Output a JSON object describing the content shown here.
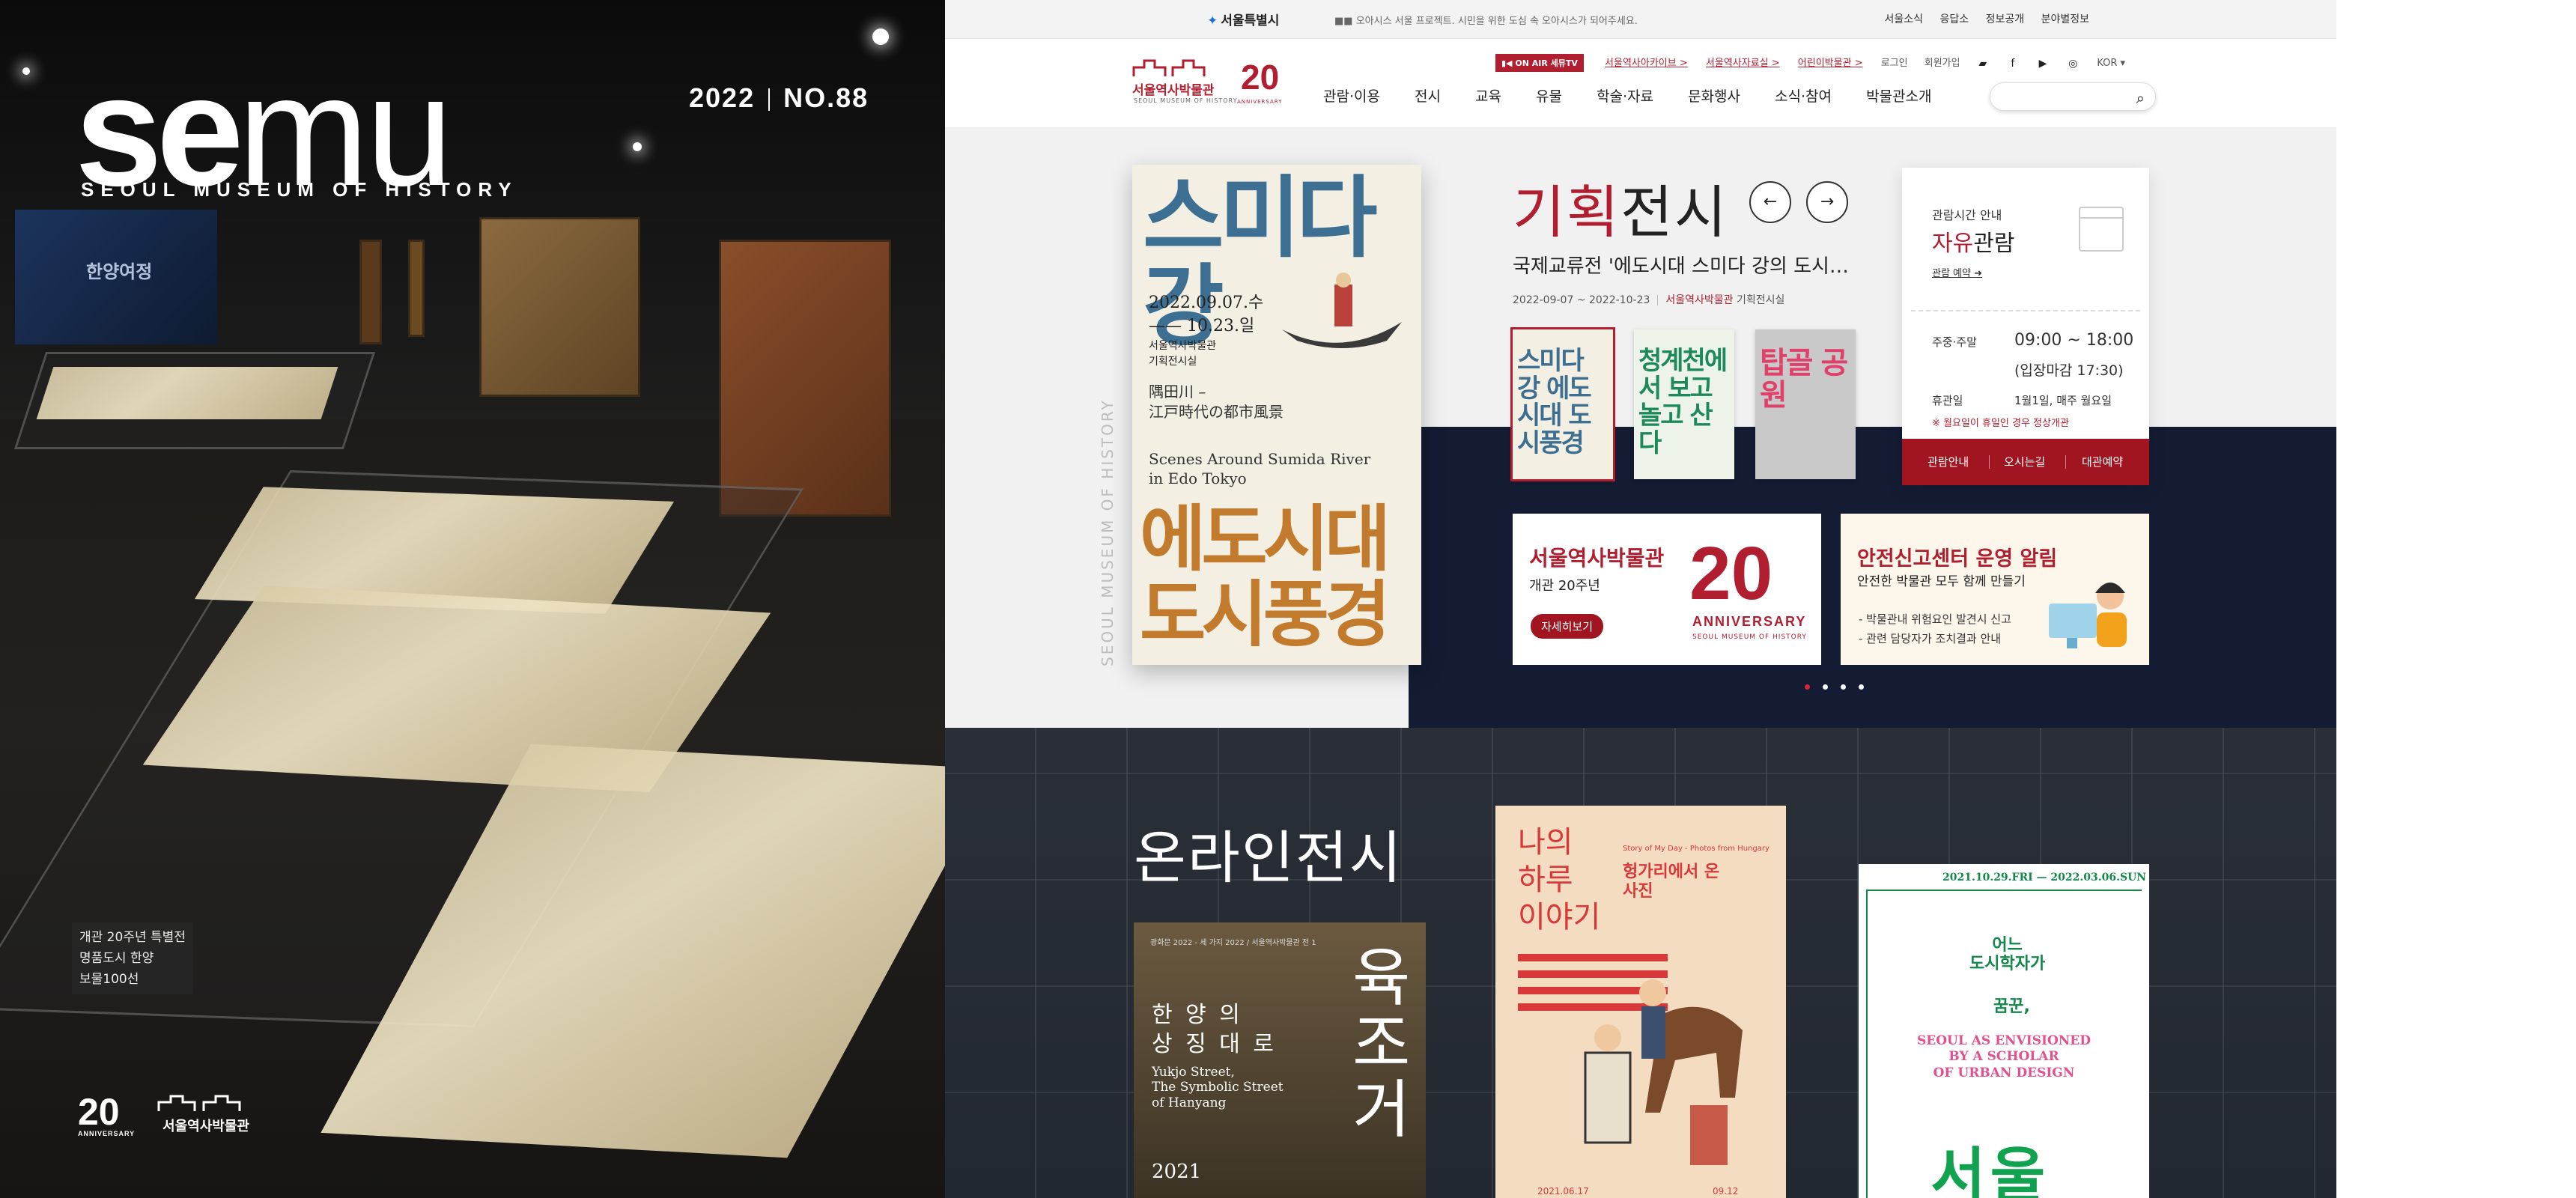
{
  "cover": {
    "logo_bold": "se",
    "logo_thin": "mu",
    "subtitle": "SEOUL MUSEUM OF HISTORY",
    "year": "2022",
    "issue": "NO.88",
    "screen_label": "한양여정",
    "caption_lines": [
      "개관 20주년 특별전",
      "명품도시 한양",
      "보물100선"
    ],
    "anniv_number": "20",
    "anniv_label": "ANNIVERSARY",
    "museum_name": "서울역사박물관"
  },
  "gov_bar": {
    "logo": "서울특별시",
    "message": "■■ 오아시스 서울 프로젝트. 시민을 위한 도심 속 오아시스가 되어주세요.",
    "links": [
      "서울소식",
      "응답소",
      "정보공개",
      "분야별정보"
    ]
  },
  "header": {
    "brand_name": "서울역사박물관",
    "brand_eng": "SEOUL MUSEUM OF HISTORY",
    "anniv_20": "20",
    "anniv_label": "ANNIVERSARY",
    "onair": "▮◀ ON AIR 세뮤TV",
    "util_links": [
      "서울역사아카이브 >",
      "서울역사자료실 >",
      "어린이박물관 >"
    ],
    "login": "로그인",
    "join": "회원가입",
    "lang": "KOR ▾",
    "gnb": [
      "관람·이용",
      "전시",
      "교육",
      "유물",
      "학술·자료",
      "문화행사",
      "소식·참여",
      "박물관소개"
    ],
    "search_placeholder": ""
  },
  "hero": {
    "vertical_text": "SEOUL MUSEUM OF HISTORY",
    "poster": {
      "title_block": "스미다 강",
      "date_lines": [
        "2022.09.07.수",
        "—— 10.23.일"
      ],
      "place_lines": [
        "서울역사박물관",
        "기획전시실"
      ],
      "jp_lines": [
        "隅田川 –",
        "江戸時代の都市風景"
      ],
      "en_lines": [
        "Scenes Around Sumida River",
        "in Edo Tokyo"
      ],
      "big_text": "에도시대 도시풍경"
    },
    "title_accent": "기획",
    "title_rest": "전시",
    "exhibit_title": "국제교류전 '에도시대 스미다 강의 도시…",
    "period": "2022-09-07 ~ 2022-10-23",
    "venue": "서울역사박물관",
    "room": "기획전시실",
    "thumbs": [
      {
        "text": "스미다 강 에도시대 도시풍경",
        "bg": "#f4efe3",
        "color": "#3d6f92"
      },
      {
        "text": "청계천에서 보고 놀고 산다",
        "bg": "#eef3ea",
        "color": "#1c8a58"
      },
      {
        "text": "탑골 공원",
        "bg": "#c9c9c9",
        "color": "#e0406a"
      }
    ],
    "prev_label": "←",
    "next_label": "→",
    "info": {
      "label": "관람시간 안내",
      "free_accent": "자유",
      "free_rest": "관람",
      "reserve": "관람 예약",
      "weekday_label": "주중·주말",
      "weekday_hours": "09:00 ~ 18:00",
      "last_entry": "(입장마감 17:30)",
      "closed_label": "휴관일",
      "closed_value": "1월1일, 매주 월요일",
      "note": "※ 월요일이 휴일인 경우 정상개관",
      "bottom_links": [
        "관람안내",
        "오시는길",
        "대관예약"
      ]
    },
    "banner1": {
      "title": "서울역사박물관",
      "subtitle": "개관 20주년",
      "button": "자세히보기",
      "anniv_number": "20",
      "anniv_label": "ANNIVERSARY",
      "museum_eng": "SEOUL MUSEUM OF HISTORY"
    },
    "banner2": {
      "title": "안전신고센터 운영 알림",
      "subtitle": "안전한 박물관 모두 함께 만들기",
      "bullets": [
        "- 박물관내 위험요인 발견시 신고",
        "- 관련 담당자가 조치결과 안내"
      ]
    }
  },
  "online": {
    "title": "온라인전시",
    "card1": {
      "top": "광화문 2022 - 세 가지 2022 / 서울역사박물관 전 1",
      "title_lines": [
        "한 양 의",
        "상 징 대 로"
      ],
      "en_lines": [
        "Yukjo Street,",
        "The Symbolic Street",
        "of Hanyang"
      ],
      "big": "육조거",
      "year": "2021"
    },
    "card2": {
      "title_lines": [
        "나의",
        "하루",
        "이야기"
      ],
      "en": "Story of My Day - Photos from Hungary",
      "sub_lines": [
        "헝가리에서 온",
        "사진"
      ],
      "date_start": "2021.06.17",
      "date_end": "09.12"
    },
    "card3": {
      "date": "2021.10.29.FRI — 2022.03.06.SUN",
      "title_lines": [
        "어느",
        "도시학자가"
      ],
      "sub": "꿈꾼,",
      "en_lines": [
        "SEOUL AS ENVISIONED",
        "BY A SCHOLAR",
        "OF URBAN DESIGN"
      ],
      "big": "서울"
    }
  },
  "colors": {
    "brand_red": "#b01e2f",
    "navy": "#131c33",
    "online_bg": "#242a33",
    "dot_active": "#d92536"
  }
}
